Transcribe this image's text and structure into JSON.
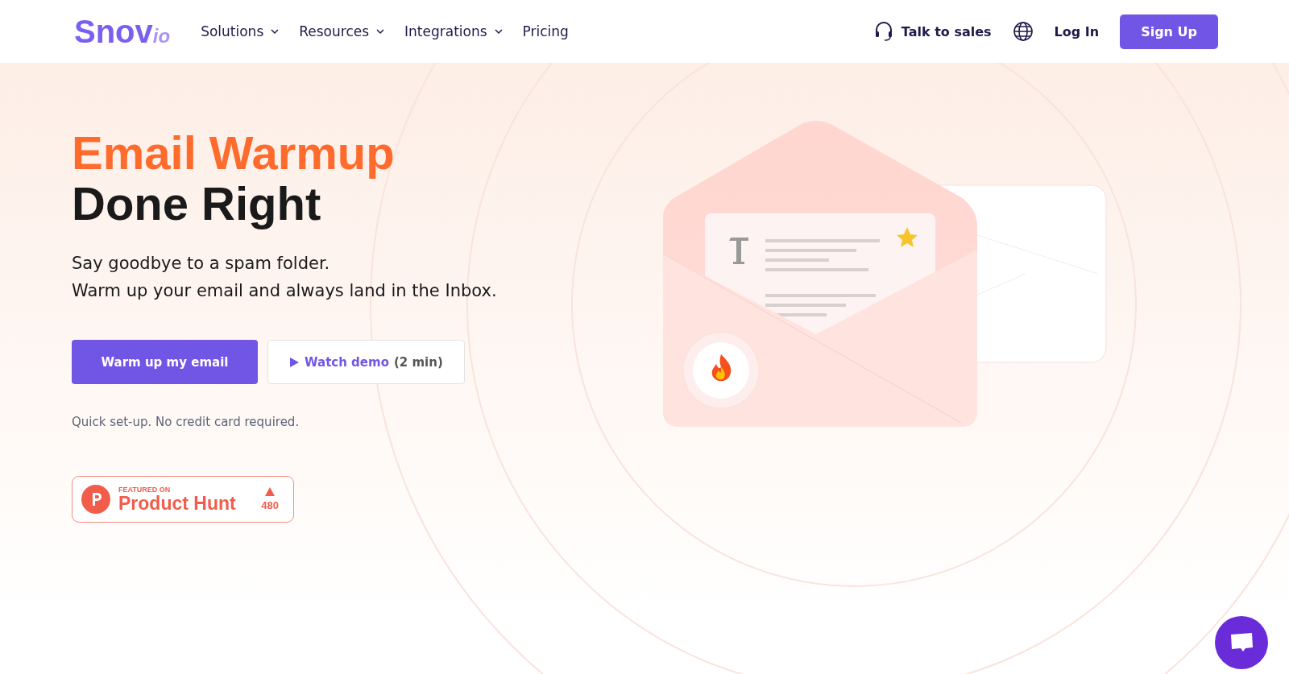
{
  "header": {
    "logo": {
      "main": "Snov",
      "suffix": "io"
    },
    "nav": [
      {
        "label": "Solutions",
        "kind": "dropdown"
      },
      {
        "label": "Resources",
        "kind": "dropdown"
      },
      {
        "label": "Integrations",
        "kind": "dropdown"
      },
      {
        "label": "Pricing",
        "kind": "link"
      }
    ],
    "talk_to_sales": "Talk to sales",
    "login": "Log In",
    "signup": "Sign Up"
  },
  "hero": {
    "title_accent": "Email Warmup",
    "title": "Done Right",
    "subtitle": [
      "Say goodbye to a spam folder.",
      "Warm up your email and always land in the Inbox."
    ],
    "primary_button": "Warm up my email",
    "demo_button": {
      "label": "Watch demo",
      "duration": "(2 min)"
    },
    "note": "Quick set-up. No credit card required.",
    "badge": {
      "featured": "FEATURED ON",
      "name": "Product Hunt",
      "votes": "480"
    }
  }
}
